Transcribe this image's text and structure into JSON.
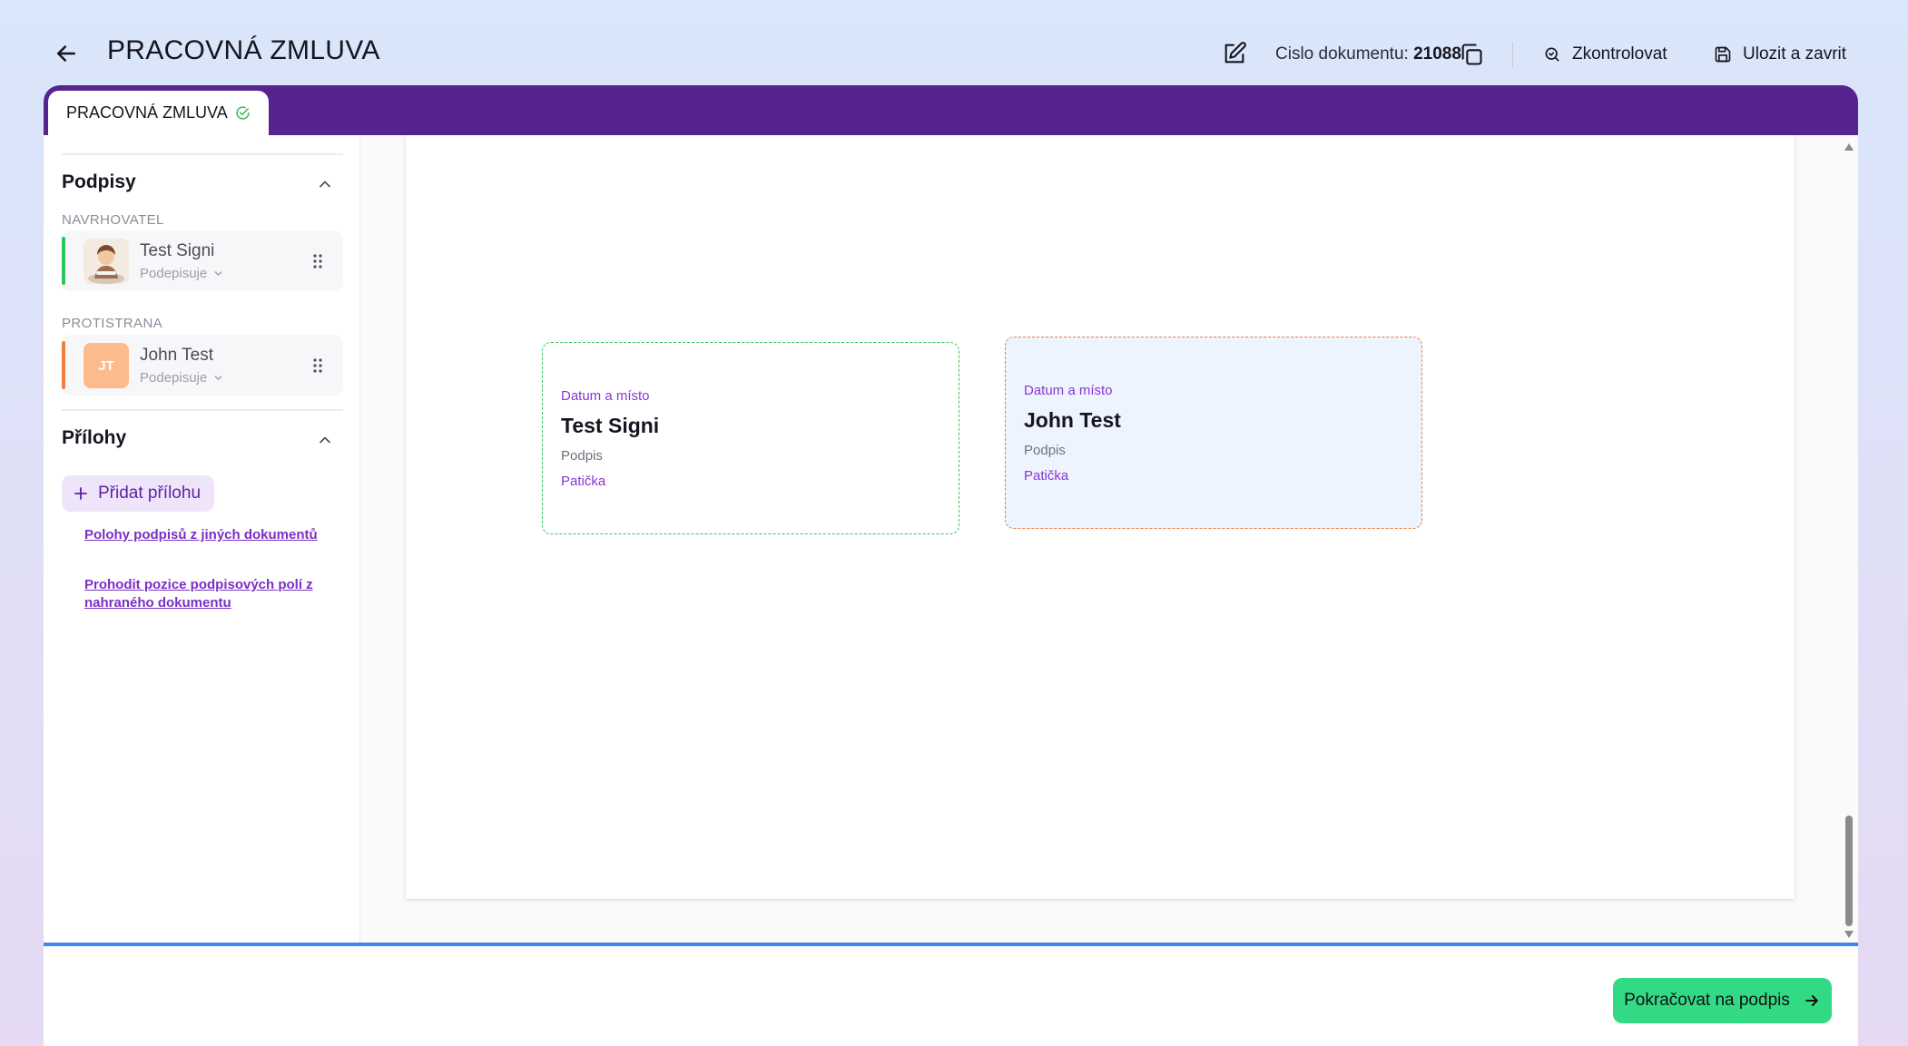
{
  "header": {
    "title": "PRACOVNÁ ZMLUVA",
    "doc_number_label": "Cislo dokumentu:",
    "doc_number_value": "21088",
    "check_label": "Zkontrolovat",
    "save_label": "Ulozit a zavrit"
  },
  "tab": {
    "label": "PRACOVNÁ ZMLUVA"
  },
  "sidebar": {
    "signatures_title": "Podpisy",
    "proposer_label": "NAVRHOVATEL",
    "counterparty_label": "PROTISTRANA",
    "signers": [
      {
        "name": "Test Signi",
        "role": "Podepisuje",
        "color": "#2ec65a"
      },
      {
        "name": "John Test",
        "initials": "JT",
        "role": "Podepisuje",
        "color": "#f07f3c"
      }
    ],
    "attachments_title": "Přílohy",
    "add_attachment_label": "Přidat přílohu",
    "link_positions_other_docs": "Polohy podpisů z jiných dokumentů",
    "link_swap_positions": "Prohodit pozice podpisových polí z nahraného dokumentu"
  },
  "document": {
    "signature_boxes": [
      {
        "place_label": "Datum a místo",
        "name": "Test Signi",
        "signature_label": "Podpis",
        "footer_label": "Patička",
        "border_color": "#34c759"
      },
      {
        "place_label": "Datum a místo",
        "name": "John Test",
        "signature_label": "Podpis",
        "footer_label": "Patička",
        "border_color": "#f07f3c"
      }
    ]
  },
  "footer": {
    "continue_label": "Pokračovat na podpis"
  },
  "colors": {
    "accent_purple": "#57238f",
    "link_purple": "#7b2fc4",
    "continue_green": "#32da85",
    "footer_blue": "#3d87ea"
  }
}
